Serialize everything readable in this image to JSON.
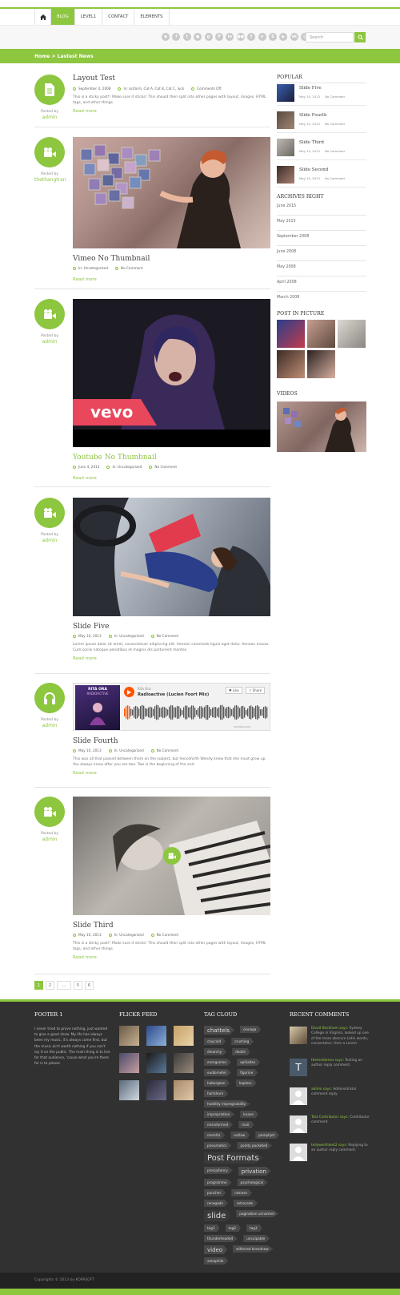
{
  "nav": {
    "items": [
      "BLOG",
      "LEVEL1",
      "CONTACT",
      "ELEMENTS"
    ]
  },
  "search": {
    "placeholder": "Search"
  },
  "breadcrumb": "Home > Lastest News",
  "social_icons": [
    "rss-icon",
    "facebook-icon",
    "twitter-icon",
    "dribbble-icon",
    "google-plus-icon",
    "pinterest-icon",
    "linkedin-icon",
    "flickr-icon",
    "tumblr-icon",
    "vimeo-icon",
    "skype-icon",
    "youtube-icon",
    "vk-icon",
    "instagram-icon"
  ],
  "posts": [
    {
      "title": "Layout Test",
      "date": "September 4, 2008",
      "cats": "In: aciform, Cat A, Cat B, Cat C, luck",
      "comments": "Comments Off",
      "posted_by": "Posted by",
      "author": "admin",
      "excerpt": "This is a sticky post!! Make sure it sticks! This should then split into other pages with layout, images, HTML tags, and other things.",
      "readmore": "Read more"
    },
    {
      "title": "Vimeo No Thumbnail",
      "date": "",
      "cats": "In: Uncategorized",
      "comments": "No Comment",
      "posted_by": "Posted by",
      "author": "thethangtran",
      "readmore": "Read more"
    },
    {
      "title": "Youtube No Thumbnail",
      "date": "June 4, 2013",
      "cats": "In: Uncategorized",
      "comments": "No Comment",
      "posted_by": "Posted by",
      "author": "admin",
      "readmore": "Read more",
      "video_brand": "vevo"
    },
    {
      "title": "Slide Five",
      "date": "May 10, 2013",
      "cats": "In: Uncategorized",
      "comments": "No Comment",
      "posted_by": "Posted by",
      "author": "admin",
      "excerpt": "Lorem ipsum dolor sit amet, consectetuer adipiscing elit. Aenean commodo ligula eget dolor. Aenean massa. Cum sociis natoque penatibus et magnis dis parturient montes.",
      "readmore": "Read more"
    },
    {
      "title": "Slide Fourth",
      "date": "May 10, 2013",
      "cats": "In: Uncategorized",
      "comments": "No Comment",
      "posted_by": "Posted by",
      "author": "admin",
      "excerpt": "This was all that passed between them on the subject, but henceforth Wendy knew that she must grow up. You always know after you are two. Two is the beginning of the end.",
      "readmore": "Read more",
      "sc_artist": "Rita Ora",
      "sc_track": "Radioactive (Lucien Foort Mix)",
      "sc_like": "Like",
      "sc_share": "Share",
      "sc_cover1": "RITA ORA",
      "sc_cover2": "RADIOACTIVE",
      "sc_brand": "SOUNDCLOUD"
    },
    {
      "title": "Slide Third",
      "date": "May 10, 2013",
      "cats": "In: Uncategorized",
      "comments": "No Comment",
      "posted_by": "Posted by",
      "author": "admin",
      "excerpt": "This is a sticky post!! Make sure it sticks! This should then split into other pages with layout, images, HTML tags, and other things.",
      "readmore": "Read more"
    }
  ],
  "pagination": [
    "1",
    "2",
    "...",
    "5",
    "6"
  ],
  "sidebar": {
    "popular_title": "POPULAR",
    "popular": [
      {
        "title": "Slide Five",
        "date": "May 10, 2013",
        "comments": "No Comment"
      },
      {
        "title": "Slide Fourth",
        "date": "May 10, 2013",
        "comments": "No Comment"
      },
      {
        "title": "Slide Third",
        "date": "May 10, 2013",
        "comments": "No Comment"
      },
      {
        "title": "Slide Second",
        "date": "May 10, 2013",
        "comments": "No Comment"
      }
    ],
    "archives_title": "ARCHIVES RIGHT",
    "archives": [
      "June 2015",
      "May 2015",
      "September 2008",
      "June 2008",
      "May 2008",
      "April 2008",
      "March 2008"
    ],
    "pictures_title": "POST IN PICTURE",
    "videos_title": "VIDEOS"
  },
  "footer": {
    "f1_title": "FOOTER 1",
    "f1_text": "I never tried to prove nothing, just wanted to give a good show. My life has always been my music, it's always come first, but the music ain't worth nothing if you can't lay it on the public. The main thing is to live for that audience, 'cause what you're there for is to please",
    "flickr_title": "FLICKR FEED",
    "tag_title": "TAG CLOUD",
    "tags": [
      [
        "chattels",
        "med"
      ],
      [
        "cienaga",
        ""
      ],
      [
        "claycold",
        ""
      ],
      [
        "crushing",
        ""
      ],
      [
        "dinarchy",
        ""
      ],
      [
        "doolie",
        ""
      ],
      [
        "energumen",
        ""
      ],
      [
        "ephialtes",
        ""
      ],
      [
        "eudiometer",
        ""
      ],
      [
        "figurine",
        ""
      ],
      [
        "habergeon",
        ""
      ],
      [
        "hapless",
        ""
      ],
      [
        "hartshorn",
        ""
      ],
      [
        "hostility impregnability",
        ""
      ],
      [
        "impropriation",
        ""
      ],
      [
        "knave",
        ""
      ],
      [
        "misinformed",
        ""
      ],
      [
        "moil",
        ""
      ],
      [
        "mornful",
        ""
      ],
      [
        "outlaw",
        ""
      ],
      [
        "pamphjet",
        ""
      ],
      [
        "pneumatics",
        ""
      ],
      [
        "pointy pocketed",
        ""
      ],
      [
        "Post Formats",
        "big"
      ],
      [
        "precipitancy",
        ""
      ],
      [
        "privation",
        "med"
      ],
      [
        "programme",
        ""
      ],
      [
        "psychological",
        ""
      ],
      [
        "puncher",
        ""
      ],
      [
        "ramose",
        ""
      ],
      [
        "renegade",
        ""
      ],
      [
        "retrocede",
        ""
      ],
      [
        "slide",
        "big"
      ],
      [
        "pagination unnamed",
        ""
      ],
      [
        "tag1",
        ""
      ],
      [
        "tag2",
        ""
      ],
      [
        "tag3",
        ""
      ],
      [
        "thunderheaded",
        ""
      ],
      [
        "unculpable",
        ""
      ],
      [
        "video",
        "med"
      ],
      [
        "withered brandnew",
        ""
      ],
      [
        "xenophile",
        ""
      ]
    ],
    "rc_title": "RECENT COMMENTS",
    "comments": [
      {
        "author": "David Beckham says:",
        "text": "Sydney College in Virginia, looked up one of the more obscure Latin words, consectetur, from a Lorem"
      },
      {
        "author": "themedemos says:",
        "text": "Testing an author reply comment."
      },
      {
        "author": "admin says:",
        "text": "Administrator comment reply."
      },
      {
        "author": "Test Contributor says:",
        "text": "Contributor comment."
      },
      {
        "author": "tellyworthtest2 says:",
        "text": "Replying to an author reply comment."
      }
    ],
    "copyright": "Copyrights © 2013 by KOPASOFT"
  }
}
